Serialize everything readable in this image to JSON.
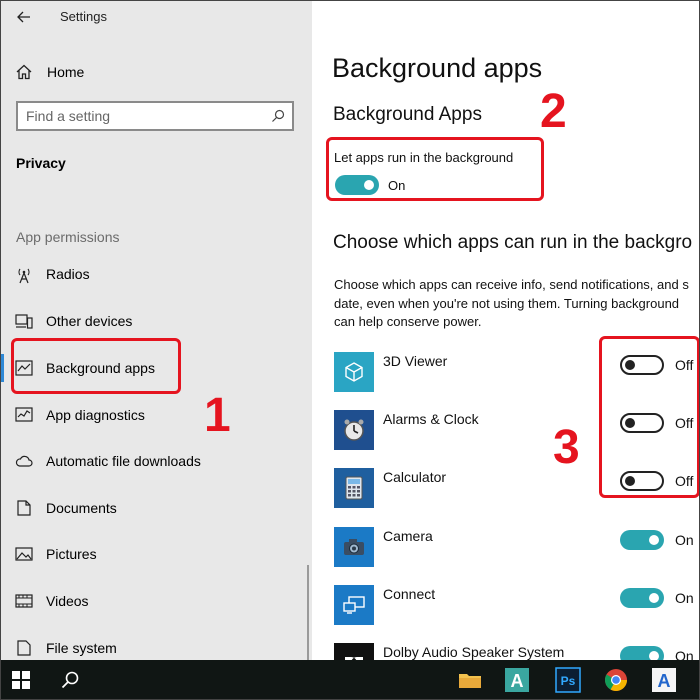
{
  "window": {
    "title": "Settings"
  },
  "sidebar": {
    "home_label": "Home",
    "search_placeholder": "Find a setting",
    "section_title": "Privacy",
    "group_title": "App permissions",
    "items": [
      {
        "label": "Radios",
        "icon": "radio-tower-icon"
      },
      {
        "label": "Other devices",
        "icon": "devices-icon"
      },
      {
        "label": "Background apps",
        "icon": "background-apps-icon",
        "active": true
      },
      {
        "label": "App diagnostics",
        "icon": "diagnostics-icon"
      },
      {
        "label": "Automatic file downloads",
        "icon": "cloud-icon"
      },
      {
        "label": "Documents",
        "icon": "document-icon"
      },
      {
        "label": "Pictures",
        "icon": "picture-icon"
      },
      {
        "label": "Videos",
        "icon": "video-icon"
      },
      {
        "label": "File system",
        "icon": "file-icon"
      }
    ]
  },
  "main": {
    "page_title": "Background apps",
    "sub_title": "Background Apps",
    "master_toggle": {
      "label": "Let apps run in the background",
      "state": "On"
    },
    "choose_title": "Choose which apps can run in the backgro",
    "description": [
      "Choose which apps can receive info, send notifications, and s",
      "date, even when you're not using them. Turning background",
      "can help conserve power."
    ],
    "apps": [
      {
        "name": "3D Viewer",
        "state": "Off",
        "icon": "cube-icon"
      },
      {
        "name": "Alarms & Clock",
        "state": "Off",
        "icon": "clock-icon"
      },
      {
        "name": "Calculator",
        "state": "Off",
        "icon": "calculator-icon"
      },
      {
        "name": "Camera",
        "state": "On",
        "icon": "camera-icon"
      },
      {
        "name": "Connect",
        "state": "On",
        "icon": "connect-icon"
      },
      {
        "name": "Dolby Audio Speaker System",
        "state": "On",
        "icon": "dolby-icon"
      }
    ]
  },
  "annotations": {
    "one": "1",
    "two": "2",
    "three": "3"
  },
  "colors": {
    "accent": "#2aa5b0",
    "tile": "#1b7ac6",
    "annotation": "#e5141f",
    "sidebar_bg": "#e8e8e8"
  },
  "taskbar": {
    "icons": [
      "windows-start-icon",
      "search-icon",
      "file-explorer-icon",
      "autocad-icon",
      "photoshop-icon",
      "chrome-icon",
      "app-a-icon"
    ]
  }
}
